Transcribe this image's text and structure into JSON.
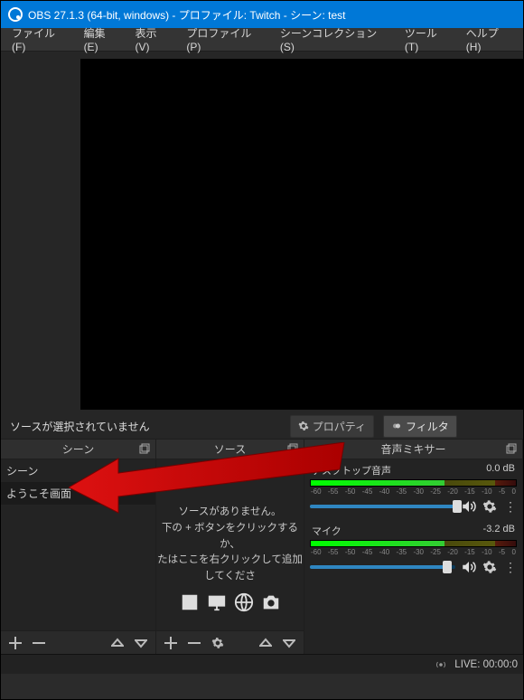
{
  "titlebar": {
    "text": "OBS 27.1.3 (64-bit, windows) - プロファイル: Twitch - シーン: test"
  },
  "menu": {
    "file": "ファイル(F)",
    "edit": "編集(E)",
    "view": "表示(V)",
    "profile": "プロファイル(P)",
    "scenecol": "シーンコレクション(S)",
    "tools": "ツール(T)",
    "help": "ヘルプ(H)"
  },
  "context": {
    "no_source": "ソースが選択されていません",
    "properties": "プロパティ",
    "filters": "フィルタ"
  },
  "panels": {
    "scenes": {
      "title": "シーン",
      "items": [
        "シーン",
        "ようこそ画面"
      ]
    },
    "sources": {
      "title": "ソース",
      "empty1": "ソースがありません。",
      "empty2": "下の + ボタンをクリックするか、",
      "empty3": "たはここを右クリックして追加してくださ"
    },
    "mixer": {
      "title": "音声ミキサー",
      "ch": [
        {
          "name": "デスクトップ音声",
          "db": "0.0 dB",
          "fill": 100,
          "knob": 98,
          "g": 65,
          "y": 25,
          "r": 10,
          "lvl": 70
        },
        {
          "name": "マイク",
          "db": "-3.2 dB",
          "fill": 93,
          "knob": 91,
          "g": 65,
          "y": 25,
          "r": 10,
          "lvl": 18
        }
      ],
      "ticks": [
        "-60",
        "-55",
        "-50",
        "-45",
        "-40",
        "-35",
        "-30",
        "-25",
        "-20",
        "-15",
        "-10",
        "-5",
        "0"
      ]
    }
  },
  "status": {
    "live": "LIVE: 00:00:0"
  }
}
